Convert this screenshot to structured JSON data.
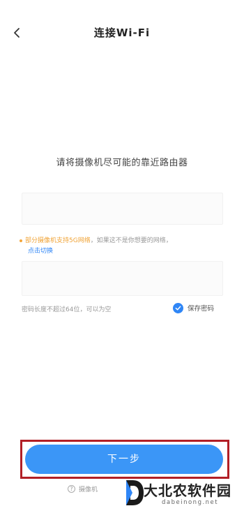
{
  "header": {
    "title": "连接Wi-Fi"
  },
  "instruction": "请将摄像机尽可能的靠近路由器",
  "wifi_field": {
    "value": "",
    "placeholder": ""
  },
  "tip": {
    "warning": "部分摄像机支持5G网络",
    "text": "，如果这不是你想要的网络，",
    "link": "点击切换"
  },
  "password_field": {
    "value": "",
    "placeholder": ""
  },
  "password_hint": "密码长度不超过64位，可以为空",
  "save_password": {
    "label": "保存密码",
    "checked": true
  },
  "next_button": {
    "label": "下一步"
  },
  "help": {
    "text": "摄像机"
  },
  "watermark": {
    "cn": "大北农软件园",
    "en": "dabeinong.net"
  },
  "colors": {
    "accent": "#3b96f7",
    "warning": "#f0a336",
    "highlight": "#b21f26"
  }
}
